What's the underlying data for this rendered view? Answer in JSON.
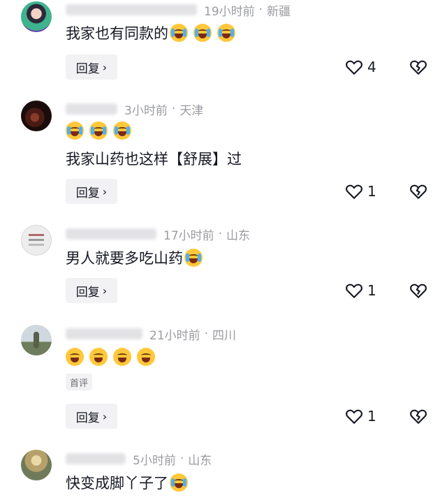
{
  "comments": [
    {
      "time": "19小时前",
      "location": "新疆",
      "text": "我家也有同款的",
      "text_emojis": 3,
      "reply_label": "回复",
      "likes": "4",
      "like_icon": "heart-outline-icon",
      "dislike_icon": "broken-heart-icon"
    },
    {
      "time": "3小时前",
      "location": "天津",
      "emoji_line_count": 3,
      "text": "我家山药也这样【舒展】过",
      "reply_label": "回复",
      "likes": "1"
    },
    {
      "time": "17小时前",
      "location": "山东",
      "text": "男人就要多吃山药",
      "text_emojis": 1,
      "reply_label": "回复",
      "likes": "1"
    },
    {
      "time": "21小时前",
      "location": "四川",
      "emoji_line_count": 4,
      "tag": "首评",
      "reply_label": "回复",
      "likes": "1"
    },
    {
      "time": "5小时前",
      "location": "山东",
      "text": "快变成脚丫子了",
      "text_emojis": 1
    }
  ],
  "separator": "·",
  "chevron": "›"
}
